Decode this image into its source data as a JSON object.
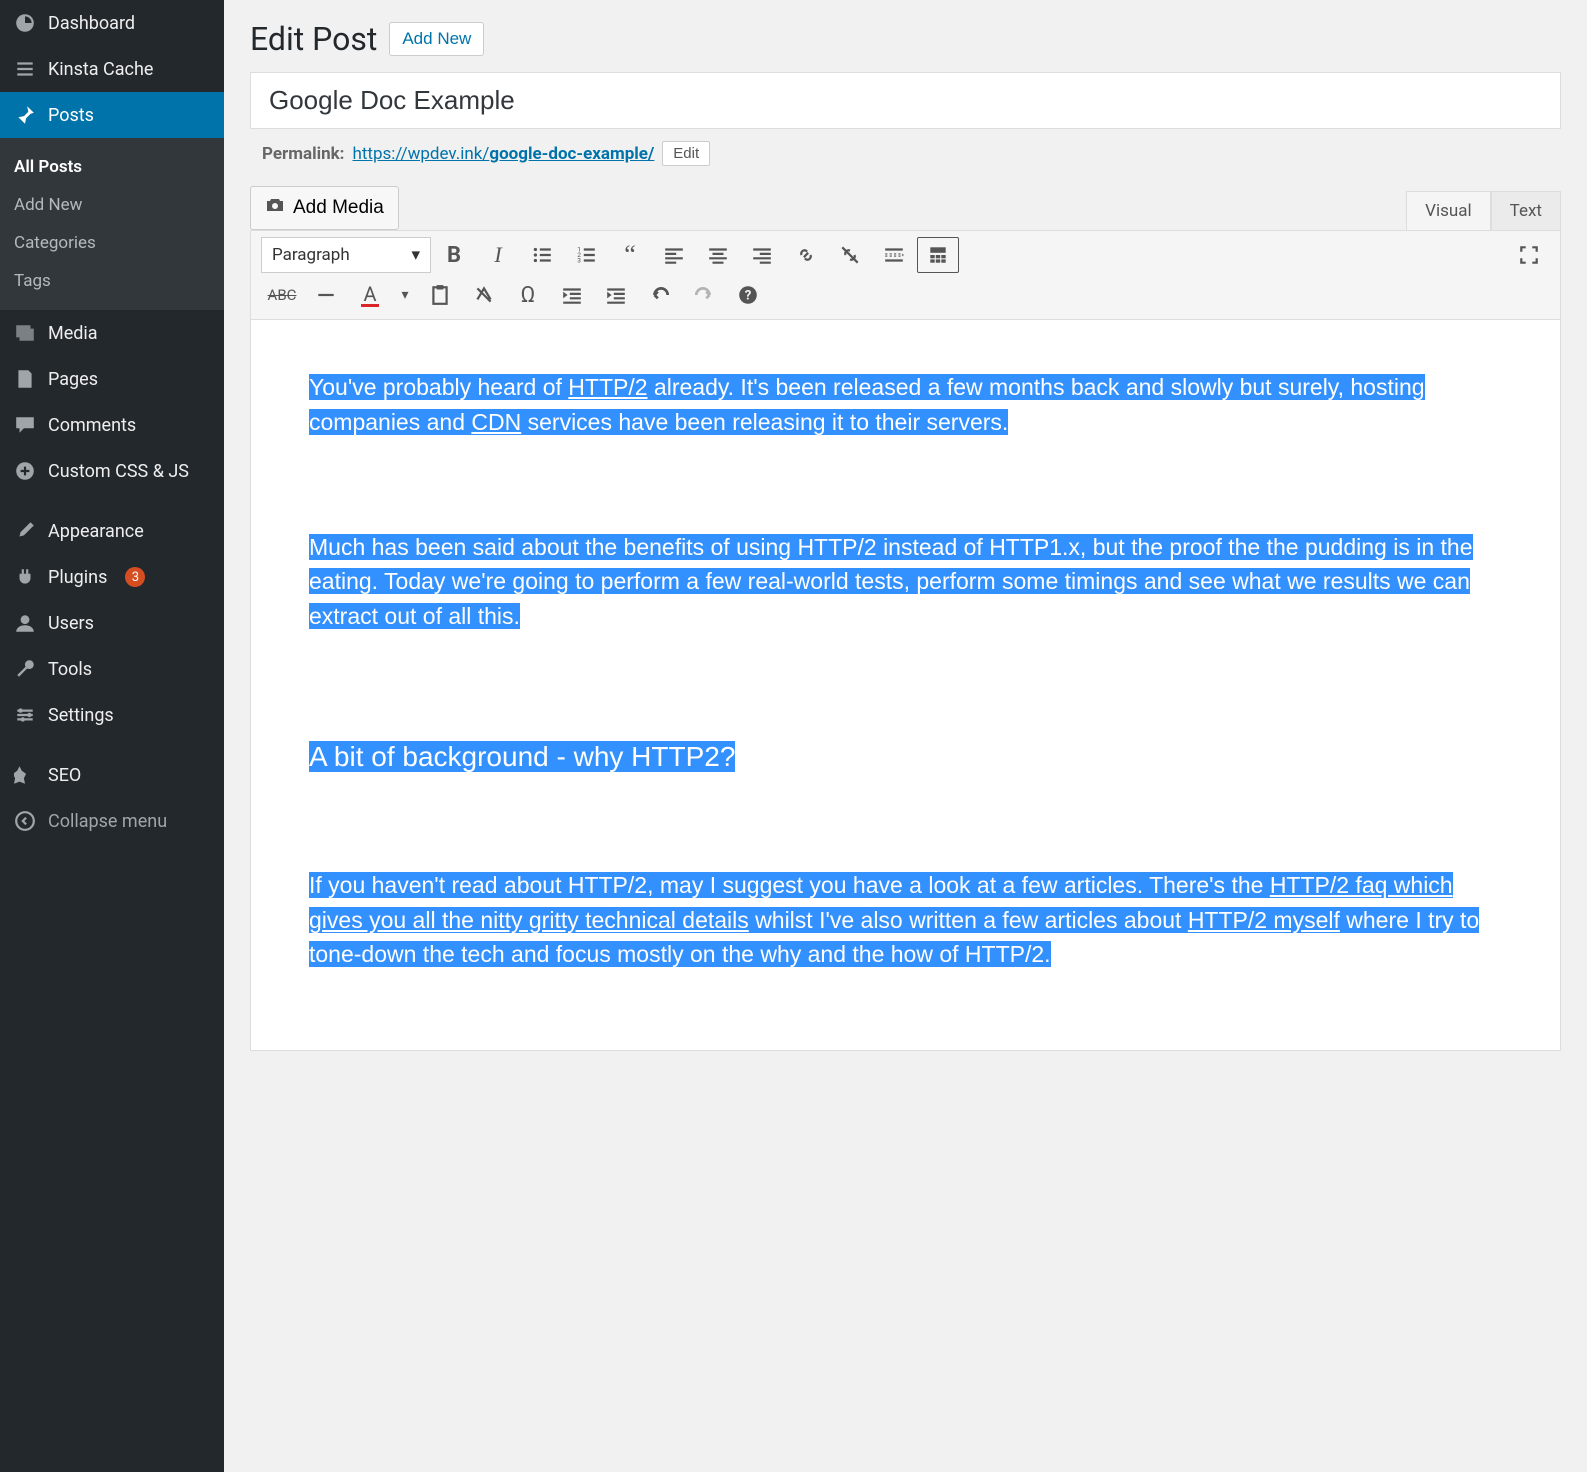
{
  "sidebar": {
    "dashboard": "Dashboard",
    "kinsta_cache": "Kinsta Cache",
    "posts": "Posts",
    "posts_submenu": {
      "all_posts": "All Posts",
      "add_new": "Add New",
      "categories": "Categories",
      "tags": "Tags"
    },
    "media": "Media",
    "pages": "Pages",
    "comments": "Comments",
    "custom_css_js": "Custom CSS & JS",
    "appearance": "Appearance",
    "plugins": "Plugins",
    "plugins_badge": "3",
    "users": "Users",
    "tools": "Tools",
    "settings": "Settings",
    "seo": "SEO",
    "collapse": "Collapse menu"
  },
  "header": {
    "edit_post": "Edit Post",
    "add_new": "Add New"
  },
  "post": {
    "title": "Google Doc Example",
    "permalink_label": "Permalink:",
    "permalink_base": "https://wpdev.ink/",
    "permalink_slug": "google-doc-example/",
    "edit_btn": "Edit"
  },
  "editor": {
    "add_media": "Add Media",
    "visual_tab": "Visual",
    "text_tab": "Text",
    "format_select": "Paragraph",
    "content_p1_a": "You've probably heard of ",
    "content_p1_link1": "HTTP/2",
    "content_p1_b": " already. It's been released a few months back and slowly but surely, hosting companies and ",
    "content_p1_link2": "CDN",
    "content_p1_c": " services have been releasing it to their servers.",
    "content_p2": "Much has been said about the benefits of using HTTP/2 instead of HTTP1.x, but the proof the the pudding is in the eating. Today we're going to perform a few real-world tests, perform some timings and see what we results we can extract out of all this.",
    "content_h2": "A bit of background - why HTTP2?",
    "content_p3_a": "If you haven't read about HTTP/2, may I suggest you have a look at a few articles. There's the ",
    "content_p3_link1": "HTTP/2 faq which gives you all the nitty gritty technical details",
    "content_p3_b": " whilst I've also written a few articles about ",
    "content_p3_link2": "HTTP/2 myself",
    "content_p3_c": " where I try to tone-down the tech and focus mostly on the why and the how of HTTP/2."
  }
}
